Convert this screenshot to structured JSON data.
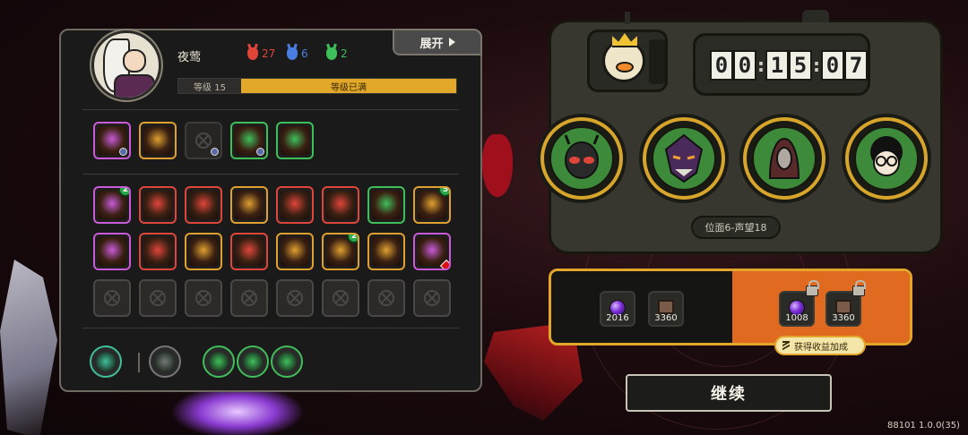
{
  "player": {
    "name": "夜莺",
    "level_label": "等级 15",
    "level_status": "等级已满"
  },
  "resources": [
    {
      "icon": "red-mask-icon",
      "value": "27",
      "color": "#e0453a"
    },
    {
      "icon": "blue-mask-icon",
      "value": "6",
      "color": "#4a7de0"
    },
    {
      "icon": "green-mask-icon",
      "value": "2",
      "color": "#3fbf5a"
    }
  ],
  "expand_label": "展开",
  "equipment_row": [
    {
      "icon": "crosshair-icon",
      "border": "#c95ad8"
    },
    {
      "icon": "beast-icon",
      "border": "#e0a030"
    },
    {
      "icon": "empty-slot-icon",
      "border": "#3e3c39"
    },
    {
      "icon": "armor-icon",
      "border": "#3fbf5a"
    },
    {
      "icon": "vine-icon",
      "border": "#3fbf5a"
    }
  ],
  "skill_rows": [
    [
      {
        "icon": "crossed-swords-icon",
        "border": "#c95ad8",
        "badge": "2"
      },
      {
        "icon": "jaw-icon",
        "border": "#e0453a"
      },
      {
        "icon": "claw-icon",
        "border": "#e0453a"
      },
      {
        "icon": "chain-icon",
        "border": "#e0a030"
      },
      {
        "icon": "shield-rune-icon",
        "border": "#e0453a"
      },
      {
        "icon": "skeleton-icon",
        "border": "#e0453a"
      },
      {
        "icon": "pillar-icon",
        "border": "#3fbf5a"
      },
      {
        "icon": "sunrise-icon",
        "border": "#e0a030",
        "badge": "5"
      }
    ],
    [
      {
        "icon": "vortex-icon",
        "border": "#c95ad8"
      },
      {
        "icon": "bullets-icon",
        "border": "#e0453a"
      },
      {
        "icon": "helm-icon",
        "border": "#e0a030"
      },
      {
        "icon": "fox-mask-icon",
        "border": "#e0453a"
      },
      {
        "icon": "gear-icon",
        "border": "#e0a030"
      },
      {
        "icon": "burst-icon",
        "border": "#e0a030",
        "badge": "2"
      },
      {
        "icon": "crystal-icon",
        "border": "#e0a030"
      },
      {
        "icon": "rune-orb-icon",
        "border": "#c95ad8"
      }
    ],
    [
      {
        "icon": "locked-slot-icon"
      },
      {
        "icon": "locked-slot-icon"
      },
      {
        "icon": "locked-slot-icon"
      },
      {
        "icon": "locked-slot-icon"
      },
      {
        "icon": "locked-slot-icon"
      },
      {
        "icon": "locked-slot-icon"
      },
      {
        "icon": "locked-slot-icon"
      },
      {
        "icon": "locked-slot-icon"
      }
    ]
  ],
  "bottom_buttons": [
    {
      "icon": "coil-icon",
      "border": "#3fbf9a"
    },
    {
      "icon": "gun-icon",
      "border": "#777"
    },
    {
      "icon": "target-icon",
      "border": "#3fbf5a"
    },
    {
      "icon": "claw-slash-icon",
      "border": "#3fbf5a"
    },
    {
      "icon": "crown-burst-icon",
      "border": "#3fbf5a"
    }
  ],
  "timer": {
    "h": "00",
    "m": "15",
    "s": "07"
  },
  "teammates": [
    {
      "icon": "mask-face-icon"
    },
    {
      "icon": "demon-face-icon"
    },
    {
      "icon": "hooded-face-icon"
    },
    {
      "icon": "glasses-face-icon"
    }
  ],
  "realm_label": "位面6-声望18",
  "rewards": {
    "base": [
      {
        "icon": "purple-orb-icon",
        "value": "2016"
      },
      {
        "icon": "tablet-icon",
        "value": "3360"
      }
    ],
    "bonus": [
      {
        "icon": "purple-orb-icon",
        "value": "1008",
        "locked": true
      },
      {
        "icon": "tablet-icon",
        "value": "3360",
        "locked": true
      }
    ],
    "bonus_label": "获得收益加成"
  },
  "continue_label": "继续",
  "version": "88101 1.0.0(35)",
  "colors": {
    "accent_gold": "#e1a829",
    "reward_orange": "#e06a1f",
    "portrait_green": "#3d8a3a"
  }
}
